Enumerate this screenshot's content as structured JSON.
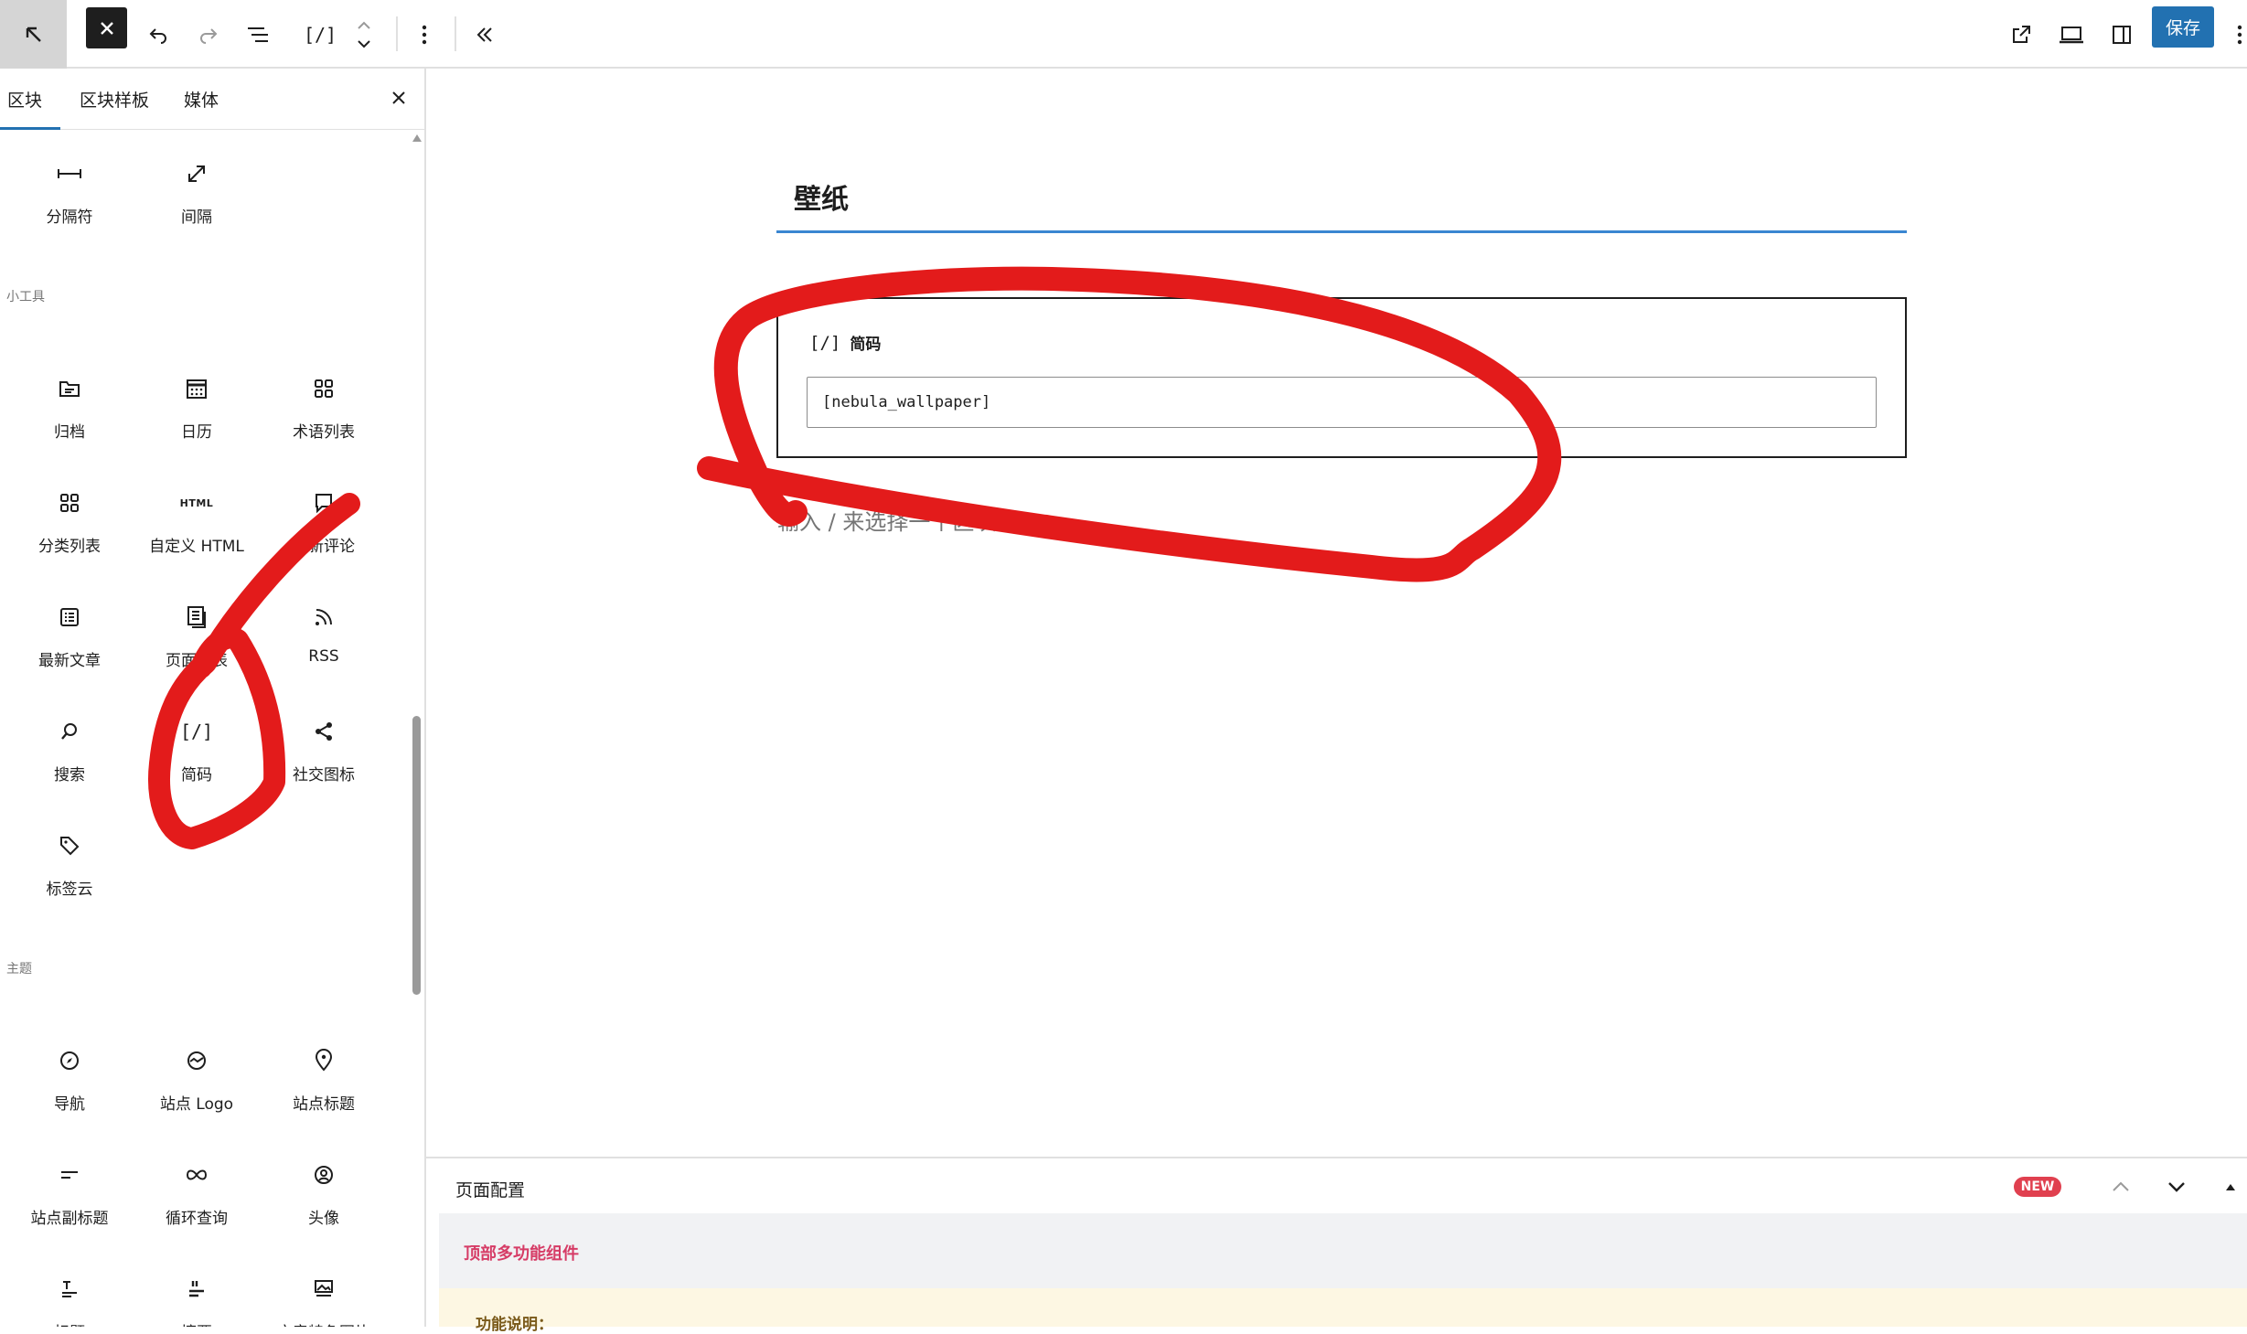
{
  "toolbar": {
    "save_label": "保存",
    "shortcode_glyph": "[/]"
  },
  "sidebar": {
    "tabs": [
      {
        "label": "区块"
      },
      {
        "label": "区块样板"
      },
      {
        "label": "媒体"
      }
    ],
    "top_blocks": [
      {
        "label": "分隔符",
        "icon": "separator-icon"
      },
      {
        "label": "间隔",
        "icon": "spacer-icon"
      }
    ],
    "widgets_section": {
      "title": "小工具",
      "blocks": [
        {
          "label": "归档",
          "icon": "archive-icon"
        },
        {
          "label": "日历",
          "icon": "calendar-icon"
        },
        {
          "label": "术语列表",
          "icon": "grid-icon"
        },
        {
          "label": "分类列表",
          "icon": "grid-icon"
        },
        {
          "label": "自定义 HTML",
          "icon": "html-icon",
          "icon_text": "HTML"
        },
        {
          "label": "最新评论",
          "icon": "comment-icon"
        },
        {
          "label": "最新文章",
          "icon": "list-icon"
        },
        {
          "label": "页面列表",
          "icon": "pages-icon"
        },
        {
          "label": "RSS",
          "icon": "rss-icon"
        },
        {
          "label": "搜索",
          "icon": "search-icon"
        },
        {
          "label": "简码",
          "icon": "shortcode-icon",
          "icon_text": "[/]"
        },
        {
          "label": "社交图标",
          "icon": "share-icon"
        },
        {
          "label": "标签云",
          "icon": "tag-icon"
        }
      ]
    },
    "theme_section": {
      "title": "主题",
      "blocks": [
        {
          "label": "导航",
          "icon": "compass-icon"
        },
        {
          "label": "站点 Logo",
          "icon": "logo-icon"
        },
        {
          "label": "站点标题",
          "icon": "map-pin-icon"
        },
        {
          "label": "站点副标题",
          "icon": "subtitle-icon"
        },
        {
          "label": "循环查询",
          "icon": "loop-icon"
        },
        {
          "label": "头像",
          "icon": "avatar-icon"
        },
        {
          "label": "标题",
          "icon": "title-icon"
        },
        {
          "label": "摘要",
          "icon": "quote-icon"
        },
        {
          "label": "文章特色图片",
          "icon": "image-icon"
        }
      ]
    }
  },
  "editor": {
    "page_title": "壁纸",
    "shortcode_block": {
      "glyph": "[/]",
      "label": "简码",
      "value": "[nebula_wallpaper]"
    },
    "placeholder": "输入 / 来选择一个区块"
  },
  "bottom_panel": {
    "title": "页面配置",
    "badge": "NEW",
    "section_title": "顶部多功能组件",
    "note_title": "功能说明："
  },
  "colors": {
    "accent": "#2271b1",
    "annotation": "#e31b1b",
    "badge": "#e0404f",
    "section_title": "#d63c66"
  }
}
